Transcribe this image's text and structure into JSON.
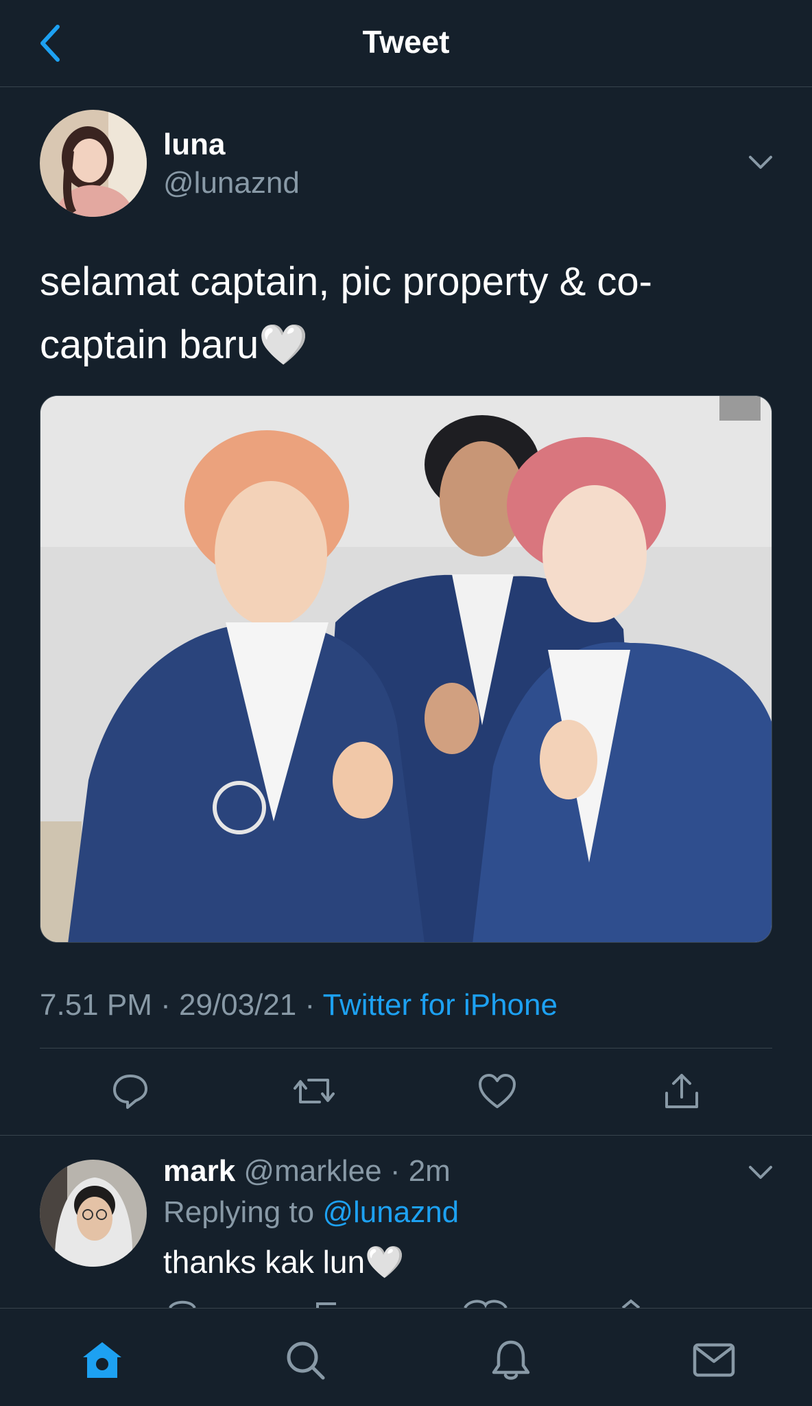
{
  "header": {
    "title": "Tweet"
  },
  "tweet": {
    "author_name": "luna",
    "author_handle": "@lunaznd",
    "text_line1": "selamat captain, pic property & co-",
    "text_line2": "captain baru🤍",
    "time": "7.51 PM",
    "sep1": " · ",
    "date": "29/03/21",
    "sep2": " · ",
    "source": "Twitter for iPhone"
  },
  "reply": {
    "name": "mark",
    "handle": "@marklee",
    "sep": " · ",
    "age": "2m",
    "replying_prefix": "Replying to ",
    "replying_to": "@lunaznd",
    "text": "thanks kak lun🤍"
  },
  "icons": {
    "back": "chevron-left-icon",
    "caret": "chevron-down-icon",
    "reply": "comment-icon",
    "retweet": "retweet-icon",
    "like": "heart-icon",
    "share": "share-icon",
    "home": "home-icon",
    "search": "search-icon",
    "notifications": "bell-icon",
    "messages": "mail-icon"
  },
  "colors": {
    "background": "#15202b",
    "accent": "#1da1f2",
    "secondary_text": "#8899a6",
    "divider": "#38444d"
  }
}
